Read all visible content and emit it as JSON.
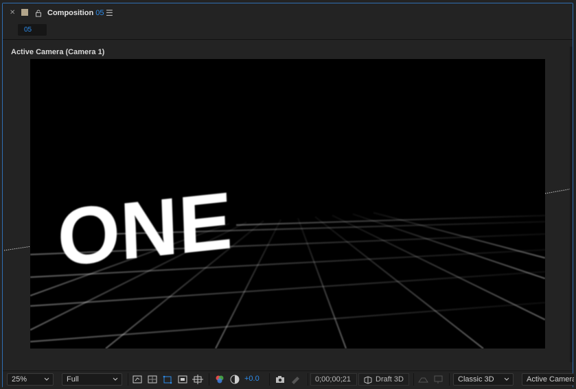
{
  "tab": {
    "title": "Composition",
    "comp_name": "05",
    "swatch_color": "#b3a58b"
  },
  "breadcrumb": {
    "item": "05"
  },
  "viewer": {
    "label": "Active Camera (Camera 1)",
    "layer_text": "ONE"
  },
  "toolbar": {
    "magnification": "25%",
    "resolution": "Full",
    "exposure": "+0.0",
    "timecode": "0;00;00;21",
    "draft3d": "Draft 3D",
    "renderer": "Classic 3D",
    "view": "Active Camera"
  },
  "colors": {
    "accent": "#2d8ceb",
    "panel_outline": "#2f6fb4"
  }
}
